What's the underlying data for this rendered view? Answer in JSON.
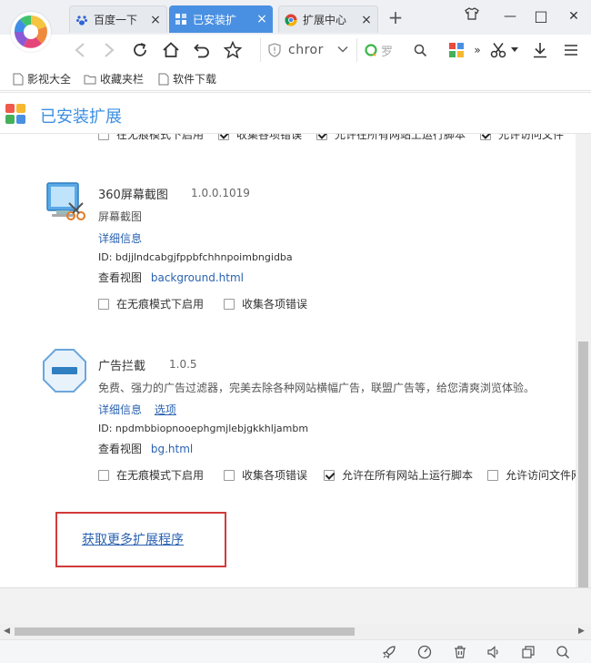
{
  "tabs": [
    {
      "label": "百度一下",
      "close": "×",
      "active": false
    },
    {
      "label": "已安装扩",
      "close": "×",
      "active": true
    },
    {
      "label": "扩展中心",
      "close": "×",
      "active": false
    }
  ],
  "new_tab": "+",
  "window_controls": {
    "minimize": "—",
    "maximize": "□",
    "close": "✕"
  },
  "toolbar": {
    "address_text": "chror",
    "search_placeholder": "罗"
  },
  "bookmarks": [
    "影视大全",
    "收藏夹栏",
    "软件下载"
  ],
  "page": {
    "title": "已安装扩展",
    "top_partial_checkboxes": [
      "在无痕模式下启用",
      "收集各项错误",
      "允许在所有网站上运行脚本",
      "允许访问文件"
    ],
    "extensions": [
      {
        "name": "360屏幕截图",
        "version": "1.0.0.1019",
        "description": "屏幕截图",
        "details_link": "详细信息",
        "options_link": "",
        "id_label": "ID: bdjjlndcabgjfppbfchhnpoimbngidba",
        "view_label": "查看视图",
        "view_link": "background.html",
        "checkboxes": [
          {
            "label": "在无痕模式下启用",
            "checked": false
          },
          {
            "label": "收集各项错误",
            "checked": false
          }
        ]
      },
      {
        "name": "广告拦截",
        "version": "1.0.5",
        "description": "免费、强力的广告过滤器，完美去除各种网站横幅广告，联盟广告等，给您清爽浏览体验。",
        "details_link": "详细信息",
        "options_link": "选项",
        "id_label": "ID: npdmbbiopnooephgmjlebjgkkhljambm",
        "view_label": "查看视图",
        "view_link": "bg.html",
        "checkboxes": [
          {
            "label": "在无痕模式下启用",
            "checked": false
          },
          {
            "label": "收集各项错误",
            "checked": false
          },
          {
            "label": "允许在所有网站上运行脚本",
            "checked": true
          },
          {
            "label": "允许访问文件网",
            "checked": false
          }
        ]
      }
    ],
    "more_extensions_link": "获取更多扩展程序"
  },
  "colors": {
    "accent": "#4a90e2",
    "title_blue": "#3d8fe0",
    "link_blue": "#2a62b0",
    "highlight_red": "#d23b3b"
  }
}
